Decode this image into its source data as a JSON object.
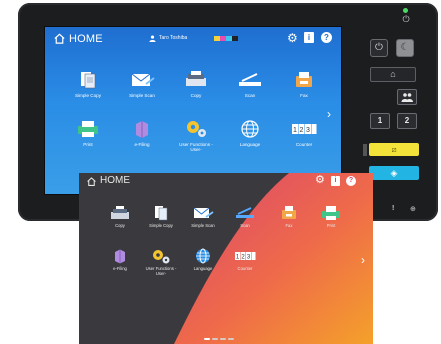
{
  "upper_screen": {
    "header": {
      "home_label": "HOME",
      "user_name": "Taro Toshiba",
      "icons": [
        "home-icon",
        "user-icon",
        "toner-indicator",
        "gear-icon",
        "info-icon",
        "help-icon"
      ]
    },
    "tiles": [
      {
        "label": "Simple Copy",
        "icon": "simple-copy-icon"
      },
      {
        "label": "Simple Scan",
        "icon": "simple-scan-icon"
      },
      {
        "label": "Copy",
        "icon": "copy-icon"
      },
      {
        "label": "Scan",
        "icon": "scan-icon"
      },
      {
        "label": "Fax",
        "icon": "fax-icon"
      },
      {
        "label": "Print",
        "icon": "print-icon"
      },
      {
        "label": "e-Filing",
        "icon": "e-filing-icon"
      },
      {
        "label": "User Functions -User-",
        "icon": "user-functions-icon"
      },
      {
        "label": "Language",
        "icon": "language-icon"
      },
      {
        "label": "Counter",
        "icon": "counter-icon"
      }
    ],
    "next_arrow": "›",
    "colors": {
      "background_top": "#1f6ed0",
      "background_bottom": "#3a9ee8"
    }
  },
  "panel": {
    "power_symbol": "⏻",
    "sleep_symbol": "☾",
    "home_symbol": "⌂",
    "people_symbol": "👥",
    "key_1": "1",
    "key_2": "2",
    "reset_symbol": "⧄",
    "start_symbol": "◈",
    "footer_alert": "!",
    "footer_right": "⊕"
  },
  "lower_screen": {
    "header": {
      "home_label": "HOME"
    },
    "tiles": [
      {
        "label": "Copy",
        "icon": "copy-icon"
      },
      {
        "label": "Simple Copy",
        "icon": "simple-copy-icon"
      },
      {
        "label": "Simple Scan",
        "icon": "simple-scan-icon"
      },
      {
        "label": "Scan",
        "icon": "scan-icon"
      },
      {
        "label": "Fax",
        "icon": "fax-icon"
      },
      {
        "label": "Print",
        "icon": "print-icon"
      },
      {
        "label": "e-Filing",
        "icon": "e-filing-icon"
      },
      {
        "label": "User Functions -User-",
        "icon": "user-functions-icon"
      },
      {
        "label": "Language",
        "icon": "language-icon"
      },
      {
        "label": "Counter",
        "icon": "counter-icon"
      }
    ],
    "next_arrow": "›",
    "page_indicator": {
      "pages": 4,
      "current": 1
    },
    "colors": {
      "dark": "#3a3a3e",
      "gradient_start": "#d9456e",
      "gradient_end": "#f4a12a"
    }
  }
}
